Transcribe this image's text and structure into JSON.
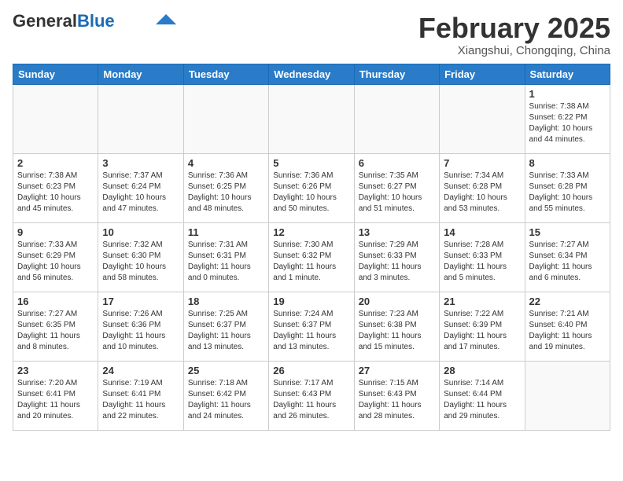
{
  "header": {
    "logo_general": "General",
    "logo_blue": "Blue",
    "month_title": "February 2025",
    "location": "Xiangshui, Chongqing, China"
  },
  "weekdays": [
    "Sunday",
    "Monday",
    "Tuesday",
    "Wednesday",
    "Thursday",
    "Friday",
    "Saturday"
  ],
  "weeks": [
    [
      {
        "day": "",
        "info": ""
      },
      {
        "day": "",
        "info": ""
      },
      {
        "day": "",
        "info": ""
      },
      {
        "day": "",
        "info": ""
      },
      {
        "day": "",
        "info": ""
      },
      {
        "day": "",
        "info": ""
      },
      {
        "day": "1",
        "info": "Sunrise: 7:38 AM\nSunset: 6:22 PM\nDaylight: 10 hours and 44 minutes."
      }
    ],
    [
      {
        "day": "2",
        "info": "Sunrise: 7:38 AM\nSunset: 6:23 PM\nDaylight: 10 hours and 45 minutes."
      },
      {
        "day": "3",
        "info": "Sunrise: 7:37 AM\nSunset: 6:24 PM\nDaylight: 10 hours and 47 minutes."
      },
      {
        "day": "4",
        "info": "Sunrise: 7:36 AM\nSunset: 6:25 PM\nDaylight: 10 hours and 48 minutes."
      },
      {
        "day": "5",
        "info": "Sunrise: 7:36 AM\nSunset: 6:26 PM\nDaylight: 10 hours and 50 minutes."
      },
      {
        "day": "6",
        "info": "Sunrise: 7:35 AM\nSunset: 6:27 PM\nDaylight: 10 hours and 51 minutes."
      },
      {
        "day": "7",
        "info": "Sunrise: 7:34 AM\nSunset: 6:28 PM\nDaylight: 10 hours and 53 minutes."
      },
      {
        "day": "8",
        "info": "Sunrise: 7:33 AM\nSunset: 6:28 PM\nDaylight: 10 hours and 55 minutes."
      }
    ],
    [
      {
        "day": "9",
        "info": "Sunrise: 7:33 AM\nSunset: 6:29 PM\nDaylight: 10 hours and 56 minutes."
      },
      {
        "day": "10",
        "info": "Sunrise: 7:32 AM\nSunset: 6:30 PM\nDaylight: 10 hours and 58 minutes."
      },
      {
        "day": "11",
        "info": "Sunrise: 7:31 AM\nSunset: 6:31 PM\nDaylight: 11 hours and 0 minutes."
      },
      {
        "day": "12",
        "info": "Sunrise: 7:30 AM\nSunset: 6:32 PM\nDaylight: 11 hours and 1 minute."
      },
      {
        "day": "13",
        "info": "Sunrise: 7:29 AM\nSunset: 6:33 PM\nDaylight: 11 hours and 3 minutes."
      },
      {
        "day": "14",
        "info": "Sunrise: 7:28 AM\nSunset: 6:33 PM\nDaylight: 11 hours and 5 minutes."
      },
      {
        "day": "15",
        "info": "Sunrise: 7:27 AM\nSunset: 6:34 PM\nDaylight: 11 hours and 6 minutes."
      }
    ],
    [
      {
        "day": "16",
        "info": "Sunrise: 7:27 AM\nSunset: 6:35 PM\nDaylight: 11 hours and 8 minutes."
      },
      {
        "day": "17",
        "info": "Sunrise: 7:26 AM\nSunset: 6:36 PM\nDaylight: 11 hours and 10 minutes."
      },
      {
        "day": "18",
        "info": "Sunrise: 7:25 AM\nSunset: 6:37 PM\nDaylight: 11 hours and 13 minutes."
      },
      {
        "day": "19",
        "info": "Sunrise: 7:24 AM\nSunset: 6:37 PM\nDaylight: 11 hours and 13 minutes."
      },
      {
        "day": "20",
        "info": "Sunrise: 7:23 AM\nSunset: 6:38 PM\nDaylight: 11 hours and 15 minutes."
      },
      {
        "day": "21",
        "info": "Sunrise: 7:22 AM\nSunset: 6:39 PM\nDaylight: 11 hours and 17 minutes."
      },
      {
        "day": "22",
        "info": "Sunrise: 7:21 AM\nSunset: 6:40 PM\nDaylight: 11 hours and 19 minutes."
      }
    ],
    [
      {
        "day": "23",
        "info": "Sunrise: 7:20 AM\nSunset: 6:41 PM\nDaylight: 11 hours and 20 minutes."
      },
      {
        "day": "24",
        "info": "Sunrise: 7:19 AM\nSunset: 6:41 PM\nDaylight: 11 hours and 22 minutes."
      },
      {
        "day": "25",
        "info": "Sunrise: 7:18 AM\nSunset: 6:42 PM\nDaylight: 11 hours and 24 minutes."
      },
      {
        "day": "26",
        "info": "Sunrise: 7:17 AM\nSunset: 6:43 PM\nDaylight: 11 hours and 26 minutes."
      },
      {
        "day": "27",
        "info": "Sunrise: 7:15 AM\nSunset: 6:43 PM\nDaylight: 11 hours and 28 minutes."
      },
      {
        "day": "28",
        "info": "Sunrise: 7:14 AM\nSunset: 6:44 PM\nDaylight: 11 hours and 29 minutes."
      },
      {
        "day": "",
        "info": ""
      }
    ]
  ]
}
